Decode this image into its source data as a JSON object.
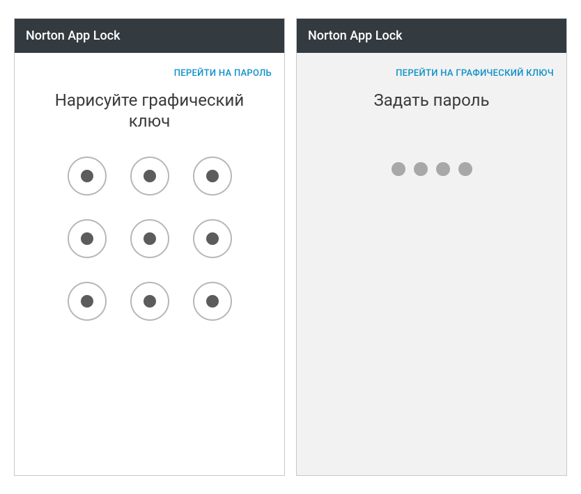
{
  "left": {
    "title": "Norton App Lock",
    "switch_link": "ПЕРЕЙТИ НА ПАРОЛЬ",
    "instruction": "Нарисуйте графический ключ"
  },
  "right": {
    "title": "Norton App Lock",
    "switch_link": "ПЕРЕЙТИ НА ГРАФИЧЕСКИЙ КЛЮЧ",
    "instruction": "Задать пароль",
    "pin_length": 4
  }
}
